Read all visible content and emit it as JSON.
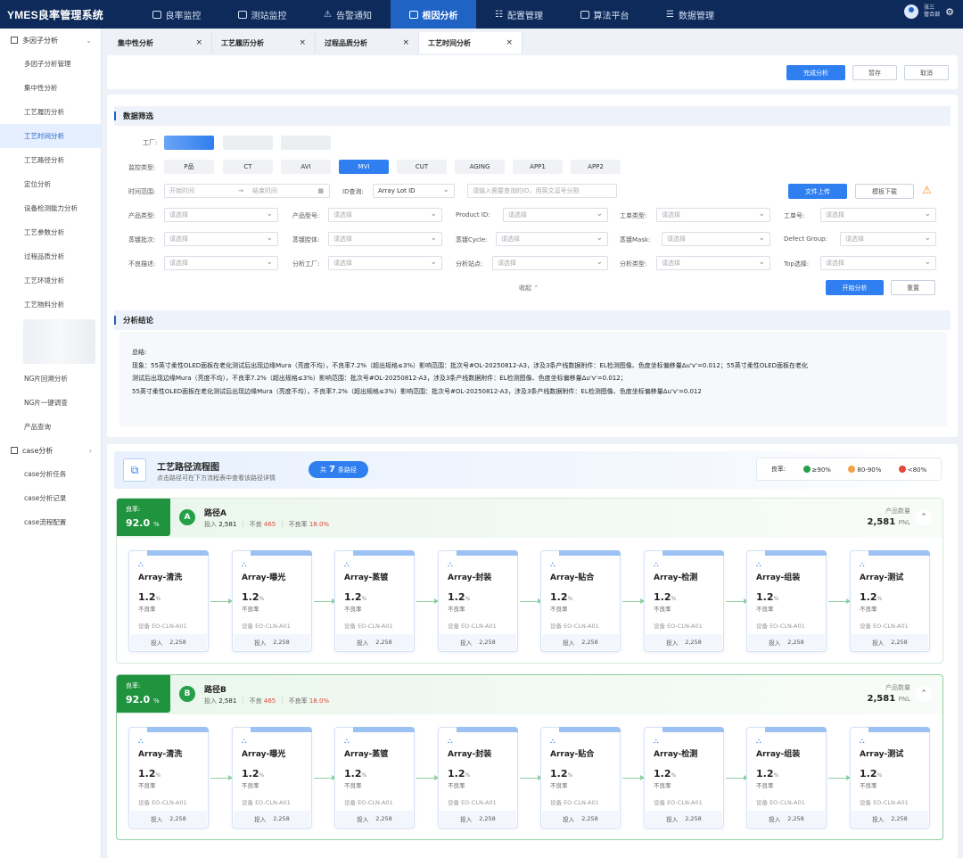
{
  "app": {
    "title": "YMES良率管理系统"
  },
  "nav": [
    {
      "label": "良率监控"
    },
    {
      "label": "测站监控"
    },
    {
      "label": "告警通知"
    },
    {
      "label": "根因分析"
    },
    {
      "label": "配置管理"
    },
    {
      "label": "算法平台"
    },
    {
      "label": "数据管理"
    }
  ],
  "user": {
    "name": "张三",
    "dept": "管合部"
  },
  "sidebar": {
    "group1": "多因子分析",
    "items1": [
      "多因子分析管理",
      "集中性分析",
      "工艺履历分析",
      "工艺时间分析",
      "工艺路径分析",
      "定位分析",
      "设备检测能力分析",
      "工艺参数分析",
      "过程品质分析",
      "工艺环境分析",
      "工艺物料分析"
    ],
    "items1b": [
      "NG片回溯分析",
      "NG片一键调查",
      "产品查询"
    ],
    "group2": "case分析",
    "items2": [
      "case分析任务",
      "case分析记录",
      "case流程配置"
    ]
  },
  "tabs": [
    {
      "label": "集中性分析",
      "close": "×"
    },
    {
      "label": "工艺履历分析",
      "close": "×"
    },
    {
      "label": "过程品质分析",
      "close": "×"
    },
    {
      "label": "工艺时间分析",
      "close": "×"
    }
  ],
  "actions": {
    "complete": "完成分析",
    "save": "暂存",
    "cancel": "取消"
  },
  "filter": {
    "title": "数据筛选",
    "factory_label": "工厂:",
    "monitor_label": "监控类型:",
    "monitor_types": [
      "P品",
      "CT",
      "AVI",
      "MVI",
      "CUT",
      "AGING",
      "APP1",
      "APP2"
    ],
    "time_label": "时间范围:",
    "time_start": "开始时间",
    "time_arrow": "→",
    "time_end": "结束时间",
    "id_label": "ID查询:",
    "id_type": "Array Lot ID",
    "id_placeholder": "请输入需要查询的ID，用英文逗号分割",
    "upload": "文件上传",
    "download": "模板下载",
    "rows": [
      [
        {
          "label": "产品类型:",
          "ph": "请选择"
        },
        {
          "label": "产品型号:",
          "ph": "请选择"
        },
        {
          "label": "Product ID:",
          "ph": "请选择"
        },
        {
          "label": "工单类型:",
          "ph": "请选择"
        },
        {
          "label": "工单号:",
          "ph": "请选择"
        }
      ],
      [
        {
          "label": "蒸镀批次:",
          "ph": "请选择"
        },
        {
          "label": "蒸镀腔体:",
          "ph": "请选择"
        },
        {
          "label": "蒸镀Cycle:",
          "ph": "请选择"
        },
        {
          "label": "蒸镀Mask:",
          "ph": "请选择"
        },
        {
          "label": "Defect Group:",
          "ph": "请选择"
        }
      ],
      [
        {
          "label": "不良描述:",
          "ph": "请选择"
        },
        {
          "label": "分析工厂:",
          "ph": "请选择"
        },
        {
          "label": "分析站点:",
          "ph": "请选择"
        },
        {
          "label": "分析类型:",
          "ph": "请选择"
        },
        {
          "label": "Top选择:",
          "ph": "请选择"
        }
      ]
    ],
    "collapse": "收起 ⌃",
    "start": "开始分析",
    "reset": "重置"
  },
  "conclusion": {
    "title": "分析结论",
    "summary_label": "总结:",
    "lines": [
      "现象：55英寸柔性OLED面板在老化测试后出现边缘Mura（亮度不均），不良率7.2%（超出规格≤3%）影响范围：批次号#OL-20250812-A3，涉及3条产线数据附件：EL检测图像、色度坐标偏移量Δu'v'=0.012；55英寸柔性OLED面板在老化",
      "测试后出现边缘Mura（亮度不均），不良率7.2%（超出规格≤3%）影响范围：批次号#OL-20250812-A3，涉及3条产线数据附件：EL检测图像、色度坐标偏移量Δu'v'=0.012；",
      "55英寸柔性OLED面板在老化测试后出现边缘Mura（亮度不均），不良率7.2%（超出规格≤3%）影响范围：批次号#OL-20250812-A3，涉及3条产线数据附件：EL检测图像、色度坐标偏移量Δu'v'=0.012"
    ]
  },
  "flow": {
    "title": "工艺路径流程图",
    "subtitle": "点击路径可在下方流程表中查看该路径详情",
    "count_prefix": "共",
    "count": "7",
    "count_suffix": "条路径",
    "legend": {
      "label": "良率:",
      "good": "≥90%",
      "mid": "80-90%",
      "bad": "<80%"
    },
    "colors": {
      "good": "#25a048",
      "mid": "#f0a14a",
      "bad": "#e5483c"
    },
    "paths": [
      {
        "tag_label": "良率:",
        "yield": "92.0",
        "unit": "%",
        "badge": "A",
        "name": "路径A",
        "input_label": "投入",
        "input": "2,581",
        "ng_label": "不良",
        "ng": "465",
        "rate_label": "不良率",
        "rate": "18.0%",
        "count_label": "产品数量",
        "count": "2,581",
        "count_unit": "PNL",
        "nodes": [
          {
            "name": "Array-清洗",
            "rate": "1.2",
            "unit": "%",
            "rate_label": "不良率",
            "equip": "设备 EO-CLN-A01",
            "in_label": "投入",
            "in": "2,258"
          },
          {
            "name": "Array-曝光",
            "rate": "1.2",
            "unit": "%",
            "rate_label": "不良率",
            "equip": "设备 EO-CLN-A01",
            "in_label": "投入",
            "in": "2,258"
          },
          {
            "name": "Array-蒸镀",
            "rate": "1.2",
            "unit": "%",
            "rate_label": "不良率",
            "equip": "设备 EO-CLN-A01",
            "in_label": "投入",
            "in": "2,258"
          },
          {
            "name": "Array-封装",
            "rate": "1.2",
            "unit": "%",
            "rate_label": "不良率",
            "equip": "设备 EO-CLN-A01",
            "in_label": "投入",
            "in": "2,258"
          },
          {
            "name": "Array-贴合",
            "rate": "1.2",
            "unit": "%",
            "rate_label": "不良率",
            "equip": "设备 EO-CLN-A01",
            "in_label": "投入",
            "in": "2,258"
          },
          {
            "name": "Array-检测",
            "rate": "1.2",
            "unit": "%",
            "rate_label": "不良率",
            "equip": "设备 EO-CLN-A01",
            "in_label": "投入",
            "in": "2,258"
          },
          {
            "name": "Array-组装",
            "rate": "1.2",
            "unit": "%",
            "rate_label": "不良率",
            "equip": "设备 EO-CLN-A01",
            "in_label": "投入",
            "in": "2,258"
          },
          {
            "name": "Array-测试",
            "rate": "1.2",
            "unit": "%",
            "rate_label": "不良率",
            "equip": "设备 EO-CLN-A01",
            "in_label": "投入",
            "in": "2,258"
          }
        ]
      },
      {
        "tag_label": "良率:",
        "yield": "92.0",
        "unit": "%",
        "badge": "B",
        "name": "路径B",
        "input_label": "投入",
        "input": "2,581",
        "ng_label": "不良",
        "ng": "465",
        "rate_label": "不良率",
        "rate": "18.0%",
        "count_label": "产品数量",
        "count": "2,581",
        "count_unit": "PNL",
        "nodes": [
          {
            "name": "Array-清洗",
            "rate": "1.2",
            "unit": "%",
            "rate_label": "不良率",
            "equip": "设备 EO-CLN-A01",
            "in_label": "投入",
            "in": "2,258"
          },
          {
            "name": "Array-曝光",
            "rate": "1.2",
            "unit": "%",
            "rate_label": "不良率",
            "equip": "设备 EO-CLN-A01",
            "in_label": "投入",
            "in": "2,258"
          },
          {
            "name": "Array-蒸镀",
            "rate": "1.2",
            "unit": "%",
            "rate_label": "不良率",
            "equip": "设备 EO-CLN-A01",
            "in_label": "投入",
            "in": "2,258"
          },
          {
            "name": "Array-封装",
            "rate": "1.2",
            "unit": "%",
            "rate_label": "不良率",
            "equip": "设备 EO-CLN-A01",
            "in_label": "投入",
            "in": "2,258"
          },
          {
            "name": "Array-贴合",
            "rate": "1.2",
            "unit": "%",
            "rate_label": "不良率",
            "equip": "设备 EO-CLN-A01",
            "in_label": "投入",
            "in": "2,258"
          },
          {
            "name": "Array-检测",
            "rate": "1.2",
            "unit": "%",
            "rate_label": "不良率",
            "equip": "设备 EO-CLN-A01",
            "in_label": "投入",
            "in": "2,258"
          },
          {
            "name": "Array-组装",
            "rate": "1.2",
            "unit": "%",
            "rate_label": "不良率",
            "equip": "设备 EO-CLN-A01",
            "in_label": "投入",
            "in": "2,258"
          },
          {
            "name": "Array-测试",
            "rate": "1.2",
            "unit": "%",
            "rate_label": "不良率",
            "equip": "设备 EO-CLN-A01",
            "in_label": "投入",
            "in": "2,258"
          }
        ]
      }
    ]
  }
}
